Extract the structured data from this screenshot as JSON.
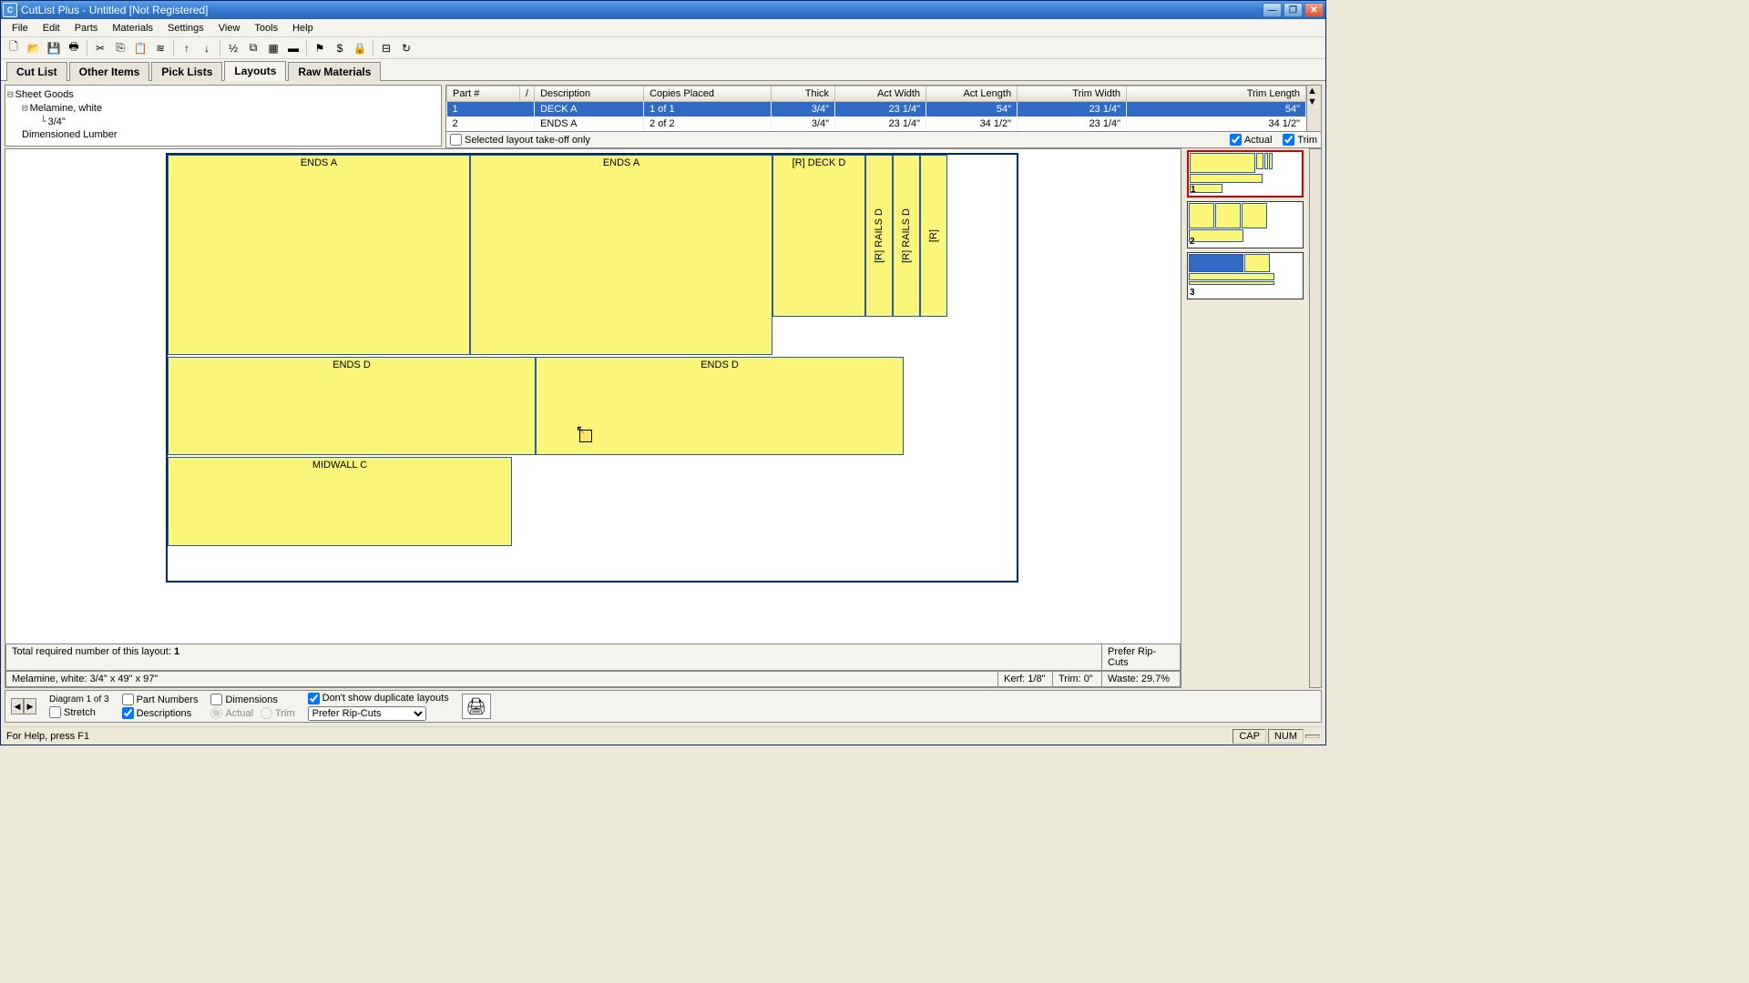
{
  "window": {
    "title": "CutList Plus - Untitled [Not Registered]"
  },
  "menus": [
    "File",
    "Edit",
    "Parts",
    "Materials",
    "Settings",
    "View",
    "Tools",
    "Help"
  ],
  "toolbar_icons": [
    "new",
    "open",
    "save",
    "print",
    "|",
    "cut",
    "copy",
    "paste",
    "brush",
    "|",
    "up",
    "down",
    "|",
    "num",
    "cols",
    "chk",
    "grid",
    "mat",
    "|",
    "flag",
    "dollar",
    "lock",
    "|",
    "tree",
    "refresh"
  ],
  "tabs": [
    "Cut List",
    "Other Items",
    "Pick Lists",
    "Layouts",
    "Raw Materials"
  ],
  "active_tab": "Layouts",
  "tree": {
    "root": "Sheet Goods",
    "child": "Melamine, white",
    "leaf": "3/4\"",
    "lumber": "Dimensioned Lumber"
  },
  "grid": {
    "headers": [
      "Part #",
      "/",
      "Description",
      "Copies Placed",
      "Thick",
      "Act Width",
      "Act Length",
      "Trim Width",
      "Trim Length"
    ],
    "rows": [
      {
        "num": "1",
        "desc": "DECK A",
        "copies": "1 of 1",
        "thick": "3/4\"",
        "aw": "23 1/4\"",
        "al": "54\"",
        "tw": "23 1/4\"",
        "tl": "54\""
      },
      {
        "num": "2",
        "desc": "ENDS A",
        "copies": "2 of 2",
        "thick": "3/4\"",
        "aw": "23 1/4\"",
        "al": "34 1/2\"",
        "tw": "23 1/4\"",
        "tl": "34 1/2\""
      }
    ]
  },
  "grid_opts": {
    "takeoff": "Selected layout take-off only",
    "actual": "Actual",
    "trim": "Trim"
  },
  "layout": {
    "parts": {
      "endsA1": "ENDS A",
      "endsA2": "ENDS A",
      "deckD": "[R] DECK D",
      "railsD1": "[R] RAILS D",
      "railsD2": "[R] RAILS D",
      "railsShort": "[R]",
      "endsD1": "ENDS D",
      "endsD2": "ENDS D",
      "midwall": "MIDWALL C"
    },
    "total_label": "Total required number of this layout:",
    "total_val": "1",
    "prefer": "Prefer Rip-Cuts",
    "material": "Melamine, white: 3/4\" x 49\" x 97\"",
    "kerf": "Kerf: 1/8\"",
    "trim": "Trim: 0\"",
    "waste": "Waste: 29.7%"
  },
  "thumbs": [
    "1",
    "2",
    "3"
  ],
  "bottom": {
    "diag": "Diagram 1 of 3",
    "stretch": "Stretch",
    "partnums": "Part Numbers",
    "dims": "Dimensions",
    "dont": "Don't show duplicate layouts",
    "desc": "Descriptions",
    "actual": "Actual",
    "trim": "Trim",
    "prefer": "Prefer Rip-Cuts"
  },
  "status": {
    "help": "For Help, press F1",
    "cap": "CAP",
    "num": "NUM"
  }
}
